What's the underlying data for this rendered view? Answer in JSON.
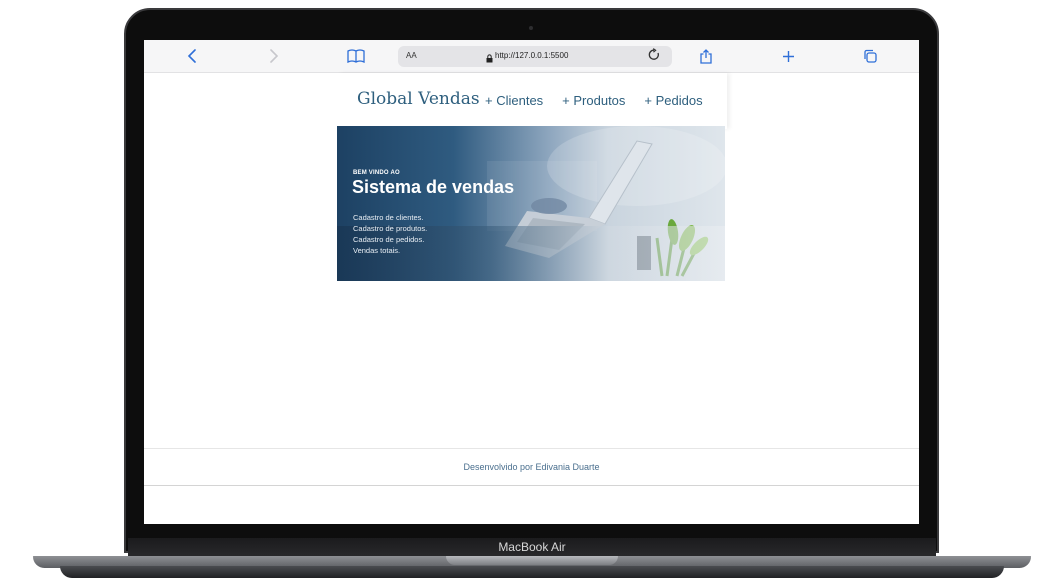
{
  "device": {
    "label": "MacBook Air"
  },
  "browser": {
    "url": "http://127.0.0.1:5500",
    "text_size_label": "AA",
    "icons": [
      "back-icon",
      "forward-icon",
      "bookmarks-icon",
      "lock-icon",
      "reload-icon",
      "share-icon",
      "new-tab-icon",
      "tabs-icon"
    ]
  },
  "site": {
    "brand": "Global Vendas",
    "nav": [
      "+ Clientes",
      "+ Produtos",
      "+ Pedidos"
    ],
    "banner": {
      "kicker": "BEM VINDO AO",
      "title": "Sistema de vendas",
      "lines": [
        "Cadastro de clientes.",
        "Cadastro de produtos.",
        "Cadastro de pedidos.",
        "Vendas totais."
      ]
    },
    "footer": "Desenvolvido por Edivania Duarte"
  },
  "colors": {
    "accent": "#2e5f7e",
    "browser_blue": "#2f6fd8"
  }
}
